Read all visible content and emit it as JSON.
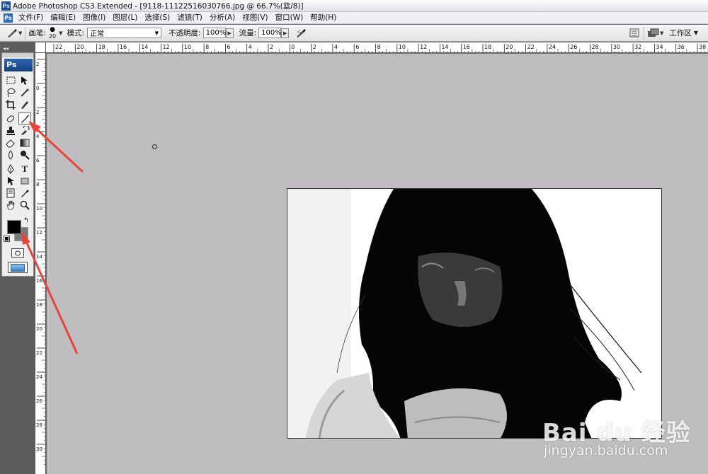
{
  "window": {
    "title": "Adobe Photoshop CS3 Extended - [9118-11122516030766.jpg @ 66.7%(蓝/8)]",
    "app_icon": "Ps"
  },
  "menu": {
    "app_icon": "Ps",
    "items": [
      "文件(F)",
      "编辑(E)",
      "图像(I)",
      "图层(L)",
      "选择(S)",
      "滤镜(T)",
      "分析(A)",
      "视图(V)",
      "窗口(W)",
      "帮助(H)"
    ]
  },
  "options": {
    "brush_label": "画笔:",
    "brush_size": "20",
    "mode_label": "模式:",
    "mode_value": "正常",
    "opacity_label": "不透明度:",
    "opacity_value": "100%",
    "flow_label": "流量:",
    "flow_value": "100%",
    "workspace_label": "工作区"
  },
  "toolbox": {
    "logo": "Ps",
    "selected_tool": "brush-tool",
    "foreground_color": "#000000",
    "background_color": "#7a7a7a"
  },
  "rulers": {
    "top_labels": [
      "22",
      "20",
      "18",
      "16",
      "14",
      "12",
      "10",
      "8",
      "6",
      "4",
      "2",
      "0",
      "2",
      "4",
      "6",
      "8",
      "10",
      "12",
      "14",
      "16",
      "18",
      "20",
      "22",
      "24",
      "26",
      "28",
      "30",
      "32",
      "34",
      "36",
      "38"
    ],
    "left_labels": [
      "2",
      "0",
      "2",
      "4",
      "6",
      "8",
      "10",
      "12",
      "14",
      "16",
      "18",
      "20",
      "22",
      "24",
      "26",
      "28",
      "30"
    ]
  },
  "watermark": {
    "logo": "Bai du 经验",
    "url": "jingyan.baidu.com"
  },
  "colors": {
    "canvas_bg": "#bfbdbf",
    "annotation_arrow": "#e8443a"
  }
}
